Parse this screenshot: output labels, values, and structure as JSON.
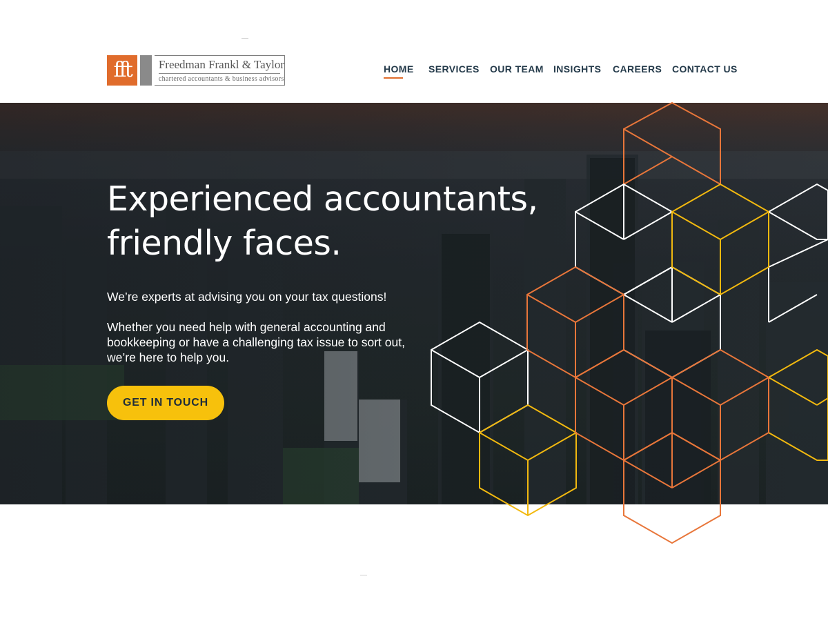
{
  "brand": {
    "mark": "fft",
    "name": "Freedman Frankl & Taylor",
    "tagline": "chartered accountants & business advisors"
  },
  "nav": {
    "items": [
      {
        "label": "HOME",
        "active": true
      },
      {
        "label": "SERVICES"
      },
      {
        "label": "OUR TEAM"
      },
      {
        "label": "INSIGHTS"
      },
      {
        "label": "CAREERS"
      },
      {
        "label": "CONTACT US"
      }
    ]
  },
  "hero": {
    "title_line1": "Experienced accountants,",
    "title_line2": "friendly faces.",
    "intro": "We’re experts at advising you on your tax questions!",
    "body": "Whether you need help with general accounting and bookkeeping or have a challenging tax issue to sort out, we’re here to help you.",
    "cta_label": "GET IN TOUCH"
  },
  "colors": {
    "accent_orange": "#e06c2c",
    "accent_yellow": "#f7c10c",
    "nav_text": "#243a4a",
    "hex_white": "#ffffff",
    "hex_orange": "#e8763a",
    "hex_yellow": "#f2b90f"
  }
}
